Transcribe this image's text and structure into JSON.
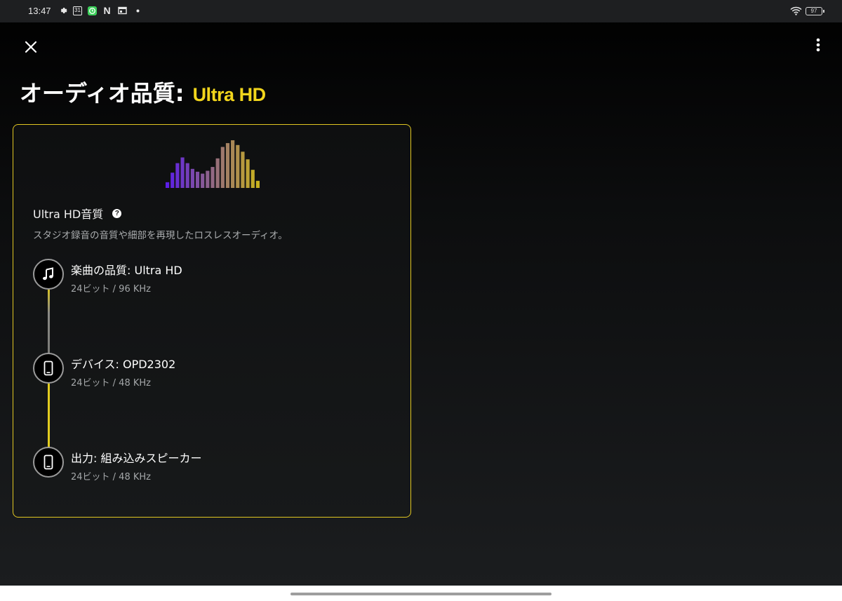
{
  "status_bar": {
    "time": "13:47",
    "icons": [
      "gear-icon",
      "calendar-icon",
      "green-app-icon",
      "netflix-icon",
      "window-icon",
      "dot-icon"
    ],
    "calendar_day": "31",
    "netflix_letter": "N",
    "wifi": "wifi-icon",
    "battery_level": "97"
  },
  "header": {
    "close": "close-icon",
    "menu": "more-vertical-icon",
    "title": "オーディオ品質:",
    "title_accent": "Ultra HD",
    "accent_color": "#f2d51c"
  },
  "card": {
    "border_color": "#e1c722",
    "heading": "Ultra HD音質",
    "help": "?",
    "description": "スタジオ録音の音質や細部を再現したロスレスオーディオ。",
    "spectrum_levels": [
      0.12,
      0.32,
      0.52,
      0.64,
      0.52,
      0.4,
      0.34,
      0.3,
      0.36,
      0.44,
      0.62,
      0.86,
      0.94,
      1.0,
      0.9,
      0.76,
      0.6,
      0.38,
      0.15
    ],
    "steps": [
      {
        "icon": "music-note-icon",
        "title": "楽曲の品質: Ultra HD",
        "detail": "24ビット / 96 KHz"
      },
      {
        "icon": "phone-icon",
        "title": "デバイス: OPD2302",
        "detail": "24ビット / 48 KHz"
      },
      {
        "icon": "phone-icon",
        "title": "出力: 組み込みスピーカー",
        "detail": "24ビット / 48 KHz"
      }
    ]
  }
}
